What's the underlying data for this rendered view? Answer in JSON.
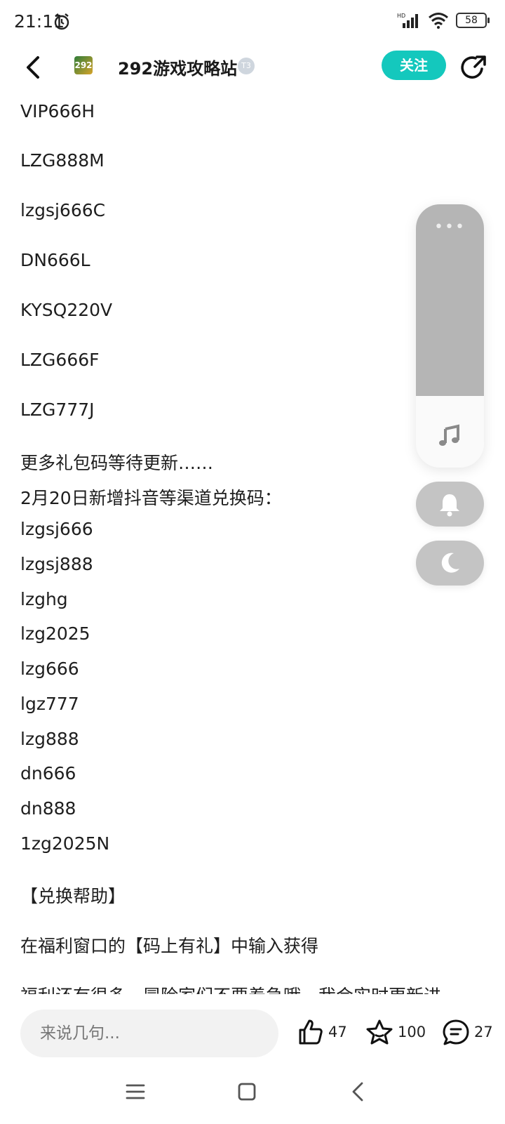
{
  "status_bar": {
    "time": "21:11",
    "battery": "58",
    "network": "HD"
  },
  "header": {
    "title": "292游戏攻略站",
    "avatar_text": "292",
    "level": "T3",
    "follow_label": "关注"
  },
  "content": {
    "lines": [
      "VIP666H",
      "LZG888M",
      "lzgsj666C",
      "DN666L",
      "KYSQ220V",
      "LZG666F",
      "LZG777J",
      "更多礼包码等待更新……",
      "2月20日新增抖音等渠道兑换码：",
      "lzgsj666",
      "lzgsj888",
      "lzghg",
      "lzg2025",
      "lzg666",
      "lgz777",
      "lzg888",
      "dn666",
      "dn888",
      "1zg2025N",
      "【兑换帮助】",
      "在福利窗口的【码上有礼】中输入获得",
      "福利还有很多，冒险家们不要着急哦，我会实时更新进"
    ]
  },
  "bottom_bar": {
    "comment_placeholder": "来说几句...",
    "likes": "47",
    "favorites": "100",
    "comments": "27"
  },
  "float_panel": {
    "menu_dots": "•••"
  }
}
